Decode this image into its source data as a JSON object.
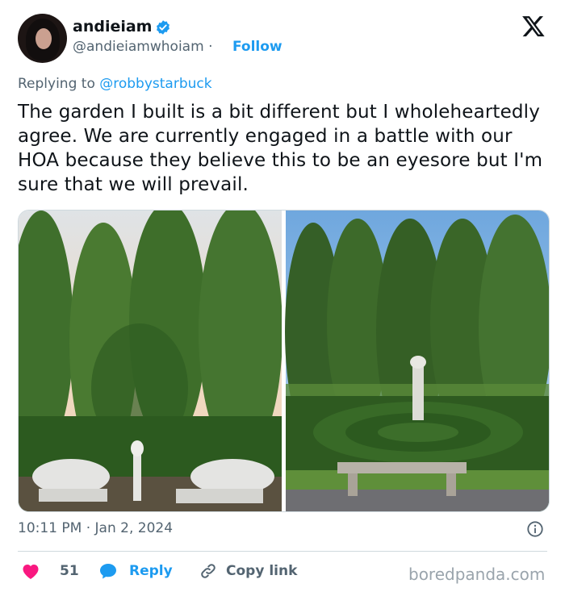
{
  "user": {
    "display_name": "andieiam",
    "handle": "@andieiamwhoiam",
    "separator": "·",
    "follow_label": "Follow"
  },
  "tweet": {
    "replying_prefix": "Replying to",
    "replying_to": "@robbystarbuck",
    "text": "The garden I built is a bit different but I wholeheartedly agree. We are currently engaged in a battle with our HOA because they believe this to be an eyesore but I'm sure that we will prevail.",
    "timestamp": "10:11 PM · Jan 2, 2024"
  },
  "actions": {
    "likes": "51",
    "reply_label": "Reply",
    "copy_label": "Copy link"
  },
  "watermark": "boredpanda.com",
  "colors": {
    "accent": "#1d9bf0",
    "heart": "#f91880",
    "muted": "#536471"
  },
  "icons": [
    "verified-badge-icon",
    "x-logo-icon",
    "info-icon",
    "heart-icon",
    "reply-bubble-icon",
    "link-icon"
  ]
}
